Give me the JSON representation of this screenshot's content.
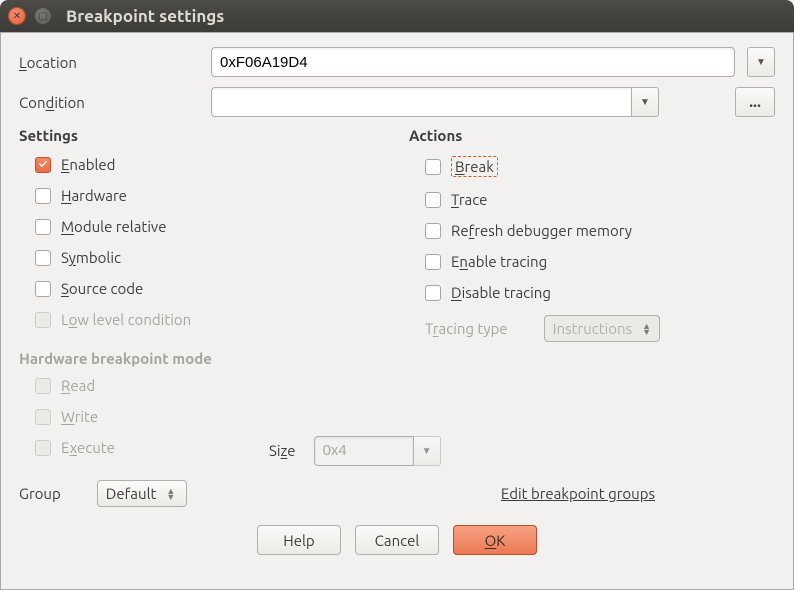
{
  "window": {
    "title": "Breakpoint settings"
  },
  "location": {
    "label_pre": "",
    "label_u": "L",
    "label_post": "ocation",
    "value": "0xF06A19D4"
  },
  "condition": {
    "label_pre": "Con",
    "label_u": "d",
    "label_post": "ition",
    "value": ""
  },
  "ellipsis": "...",
  "settings_heading": "Settings",
  "actions_heading": "Actions",
  "settings": {
    "enabled": {
      "pre": "",
      "u": "E",
      "post": "nabled",
      "checked": true
    },
    "hardware": {
      "pre": "",
      "u": "H",
      "post": "ardware",
      "checked": false
    },
    "module": {
      "pre": "",
      "u": "M",
      "post": "odule relative",
      "checked": false
    },
    "symbolic": {
      "pre": "S",
      "u": "y",
      "post": "mbolic",
      "checked": false
    },
    "source": {
      "pre": "",
      "u": "S",
      "post": "ource code",
      "checked": false
    },
    "lowlevel": {
      "pre": "L",
      "u": "o",
      "post": "w level condition",
      "checked": false
    }
  },
  "actions": {
    "break": {
      "pre": "",
      "u": "B",
      "post": "reak",
      "checked": false,
      "focused": true
    },
    "trace": {
      "pre": "",
      "u": "T",
      "post": "race",
      "checked": false
    },
    "refresh": {
      "pre": "Re",
      "u": "f",
      "post": "resh debugger memory",
      "checked": false
    },
    "entrace": {
      "pre": "E",
      "u": "n",
      "post": "able tracing",
      "checked": false
    },
    "distrace": {
      "pre": "",
      "u": "D",
      "post": "isable tracing",
      "checked": false
    }
  },
  "tracing": {
    "label_pre": "T",
    "label_u": "r",
    "label_post": "acing type",
    "value": "Instructions"
  },
  "hw_mode_heading": "Hardware breakpoint mode",
  "hw_mode": {
    "read": {
      "pre": "",
      "u": "R",
      "post": "ead"
    },
    "write": {
      "pre": "",
      "u": "W",
      "post": "rite"
    },
    "execute": {
      "pre": "E",
      "u": "x",
      "post": "ecute"
    }
  },
  "size": {
    "label_pre": "Si",
    "label_u": "z",
    "label_post": "e",
    "value": "0x4"
  },
  "group": {
    "label": "Group",
    "value": "Default"
  },
  "edit_groups": {
    "pre": "Edit breakpoint ",
    "u": "g",
    "post": "roups"
  },
  "buttons": {
    "help": "Help",
    "cancel": "Cancel",
    "ok_pre": "",
    "ok_u": "O",
    "ok_post": "K"
  }
}
